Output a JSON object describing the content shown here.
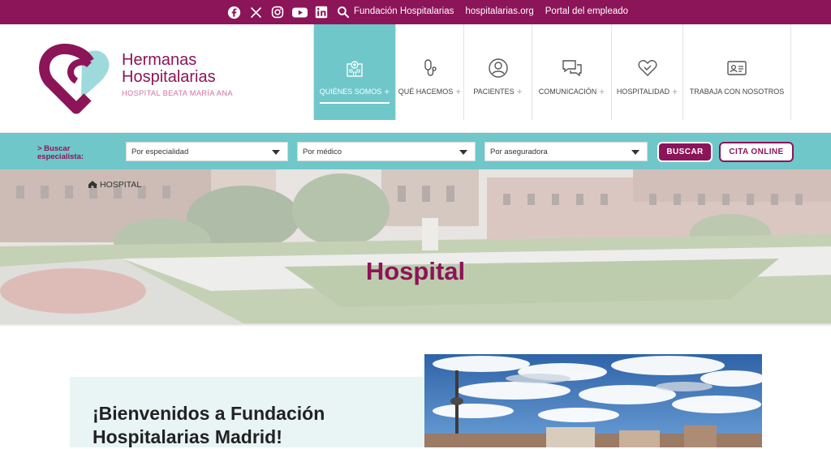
{
  "topbar": {
    "social": [
      {
        "icon": "facebook-icon"
      },
      {
        "icon": "x-icon"
      },
      {
        "icon": "instagram-icon"
      },
      {
        "icon": "youtube-icon"
      },
      {
        "icon": "linkedin-icon"
      },
      {
        "icon": "search-icon"
      }
    ],
    "links": [
      "Fundación Hospitalarias",
      "hospitalarias.org",
      "Portal del empleado"
    ]
  },
  "logo": {
    "line1": "Hermanas",
    "line2": "Hospitalarias",
    "subtitle": "HOSPITAL BEATA MARÍA ANA"
  },
  "nav": [
    {
      "label": "QUIÉNES SOMOS",
      "icon": "hospital-icon",
      "active": true
    },
    {
      "label": "QUÉ HACEMOS",
      "icon": "stethoscope-icon",
      "active": false
    },
    {
      "label": "PACIENTES",
      "icon": "user-icon",
      "active": false
    },
    {
      "label": "COMUNICACIÓN",
      "icon": "chat-icon",
      "active": false
    },
    {
      "label": "HOSPITALIDAD",
      "icon": "heart-icon",
      "active": false
    },
    {
      "label": "TRABAJA CON NOSOTROS",
      "icon": "id-card-icon",
      "active": false
    }
  ],
  "search": {
    "title_line1": "> Buscar",
    "title_line2": "especialista:",
    "specialty": "Por especialidad",
    "doctor": "Por médico",
    "insurer": "Por aseguradora",
    "buscar_label": "BUSCAR",
    "cita_label": "CITA ONLINE"
  },
  "breadcrumb": {
    "current": "> HOSPITAL"
  },
  "hero": {
    "title": "Hospital"
  },
  "welcome": {
    "title": "¡Bienvenidos a Fundación Hospitalarias Madrid!"
  },
  "colors": {
    "brand": "#8c1458",
    "accent": "#6fc7ca",
    "light": "#e9f5f5"
  }
}
